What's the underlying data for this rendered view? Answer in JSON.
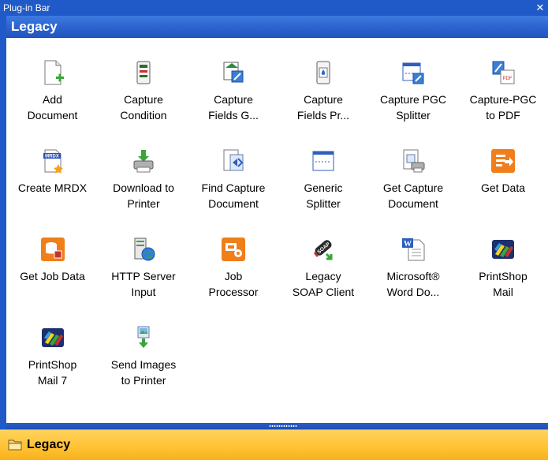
{
  "window": {
    "title": "Plug-in Bar",
    "close_glyph": "✕"
  },
  "section": {
    "title": "Legacy"
  },
  "items": [
    {
      "label": "Add\nDocument",
      "icon": "add-document-icon"
    },
    {
      "label": "Capture\nCondition",
      "icon": "capture-condition-icon"
    },
    {
      "label": "Capture\nFields G...",
      "icon": "capture-fields-g-icon"
    },
    {
      "label": "Capture\nFields Pr...",
      "icon": "capture-fields-pr-icon"
    },
    {
      "label": "Capture PGC\nSplitter",
      "icon": "capture-pgc-splitter-icon"
    },
    {
      "label": "Capture-PGC\nto PDF",
      "icon": "capture-pgc-to-pdf-icon"
    },
    {
      "label": "Create MRDX",
      "icon": "create-mrdx-icon"
    },
    {
      "label": "Download to\nPrinter",
      "icon": "download-to-printer-icon"
    },
    {
      "label": "Find Capture\nDocument",
      "icon": "find-capture-document-icon"
    },
    {
      "label": "Generic\nSplitter",
      "icon": "generic-splitter-icon"
    },
    {
      "label": "Get Capture\nDocument",
      "icon": "get-capture-document-icon"
    },
    {
      "label": "Get Data",
      "icon": "get-data-icon"
    },
    {
      "label": "Get Job Data",
      "icon": "get-job-data-icon"
    },
    {
      "label": "HTTP Server\nInput",
      "icon": "http-server-input-icon"
    },
    {
      "label": "Job\nProcessor",
      "icon": "job-processor-icon"
    },
    {
      "label": "Legacy\nSOAP Client",
      "icon": "legacy-soap-client-icon"
    },
    {
      "label": "Microsoft®\nWord Do...",
      "icon": "microsoft-word-icon"
    },
    {
      "label": "PrintShop\nMail",
      "icon": "printshop-mail-icon"
    },
    {
      "label": "PrintShop\nMail 7",
      "icon": "printshop-mail-7-icon"
    },
    {
      "label": "Send Images\nto Printer",
      "icon": "send-images-to-printer-icon"
    }
  ],
  "icon_texts": {
    "mrdx": "MRDX",
    "soap": "SOAP",
    "word": "W",
    "pdf": "PDF"
  },
  "footer": {
    "title": "Legacy"
  },
  "colors": {
    "title_bar": "#1f5ac8",
    "section_header": "#2c63cf",
    "footer_bar": "#ffc132",
    "accent_orange": "#f07e1b",
    "accent_green": "#3aa53a"
  }
}
